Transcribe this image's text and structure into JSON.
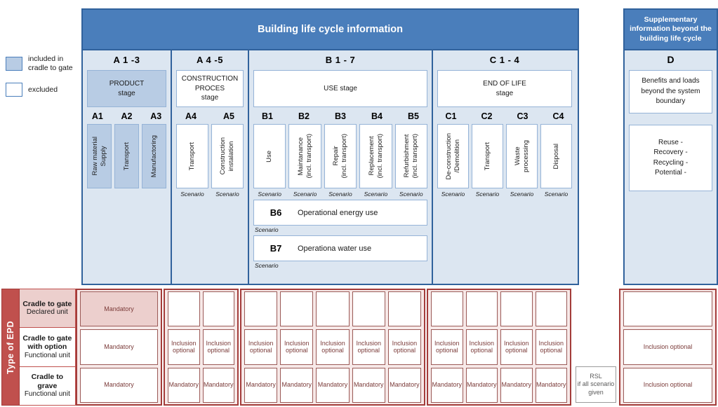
{
  "legend": {
    "items": [
      {
        "label": "included in\ncradle to gate",
        "swatch": "included",
        "color": "#b8cce4"
      },
      {
        "label": "excluded",
        "swatch": "excluded",
        "color": "#ffffff"
      }
    ]
  },
  "lifecycle": {
    "title": "Building life cycle information",
    "header_color": "#4a7ebb",
    "columns": [
      {
        "code": "A 1 -3",
        "stage": "PRODUCT\nstage",
        "stage_filled": true,
        "modules": [
          {
            "code": "A1",
            "label": "Raw material\nSupply",
            "filled": true,
            "scenario": ""
          },
          {
            "code": "A2",
            "label": "Transport",
            "filled": true,
            "scenario": ""
          },
          {
            "code": "A3",
            "label": "Manufactoring",
            "filled": true,
            "scenario": ""
          }
        ]
      },
      {
        "code": "A 4 -5",
        "stage": "CONSTRUCTION\nPROCES\nstage",
        "stage_filled": false,
        "modules": [
          {
            "code": "A4",
            "label": "Transport",
            "filled": false,
            "scenario": "Scenario"
          },
          {
            "code": "A5",
            "label": "Construction\ninstalation",
            "filled": false,
            "scenario": "Scenario"
          }
        ]
      },
      {
        "code": "B 1 - 7",
        "stage": "USE stage",
        "stage_filled": false,
        "modules": [
          {
            "code": "B1",
            "label": "Use",
            "filled": false,
            "scenario": "Scenario"
          },
          {
            "code": "B2",
            "label": "Maintanance\n(incl. transport)",
            "filled": false,
            "scenario": "Scenario"
          },
          {
            "code": "B3",
            "label": "Repair\n(incl. transport)",
            "filled": false,
            "scenario": "Scenario"
          },
          {
            "code": "B4",
            "label": "Replacement\n(incl. transport)",
            "filled": false,
            "scenario": "Scenario"
          },
          {
            "code": "B5",
            "label": "Refurbishment\n(incl. transport)",
            "filled": false,
            "scenario": "Scenario"
          }
        ],
        "wide_modules": [
          {
            "code": "B6",
            "label": "Operational energy use",
            "scenario": "Scenario"
          },
          {
            "code": "B7",
            "label": "Operationa water use",
            "scenario": "Scenario"
          }
        ]
      },
      {
        "code": "C 1 - 4",
        "stage": "END OF LIFE\nstage",
        "stage_filled": false,
        "modules": [
          {
            "code": "C1",
            "label": "De-construction\n/Demolition",
            "filled": false,
            "scenario": "Scenario"
          },
          {
            "code": "C2",
            "label": "Transport",
            "filled": false,
            "scenario": "Scenario"
          },
          {
            "code": "C3",
            "label": "Waste\nprocessing",
            "filled": false,
            "scenario": "Scenario"
          },
          {
            "code": "C4",
            "label": "Disposal",
            "filled": false,
            "scenario": "Scenario"
          }
        ]
      }
    ]
  },
  "supplementary": {
    "title": "Supplementary information beyond the building life cycle",
    "code": "D",
    "box1": "Benefits and loads\nbeyond the system\nboundary",
    "box2": "Reuse -\nRecovery -\nRecycling -\nPotential -"
  },
  "epd": {
    "side_label": "Type of EPD",
    "side_color": "#c0504d",
    "rows": [
      {
        "main": "Cradle to gate",
        "sub": "Declared unit",
        "shaded": true
      },
      {
        "main": "Cradle to gate\nwith option",
        "sub": "Functional unit",
        "shaded": false
      },
      {
        "main": "Cradle to\ngrave",
        "sub": "Functional unit",
        "shaded": false
      }
    ],
    "groups": [
      {
        "name": "a13",
        "cells": [
          [
            {
              "text": "Mandatory",
              "shaded": true
            }
          ],
          [
            {
              "text": "Mandatory",
              "shaded": false
            }
          ],
          [
            {
              "text": "Mandatory",
              "shaded": false
            }
          ]
        ]
      },
      {
        "name": "a45",
        "cells": [
          [
            {
              "text": "",
              "shaded": false
            },
            {
              "text": "",
              "shaded": false
            }
          ],
          [
            {
              "text": "Inclusion\noptional",
              "shaded": false
            },
            {
              "text": "Inclusion\noptional",
              "shaded": false
            }
          ],
          [
            {
              "text": "Mandatory",
              "shaded": false
            },
            {
              "text": "Mandatory",
              "shaded": false
            }
          ]
        ]
      },
      {
        "name": "b17",
        "cells": [
          [
            {
              "text": "",
              "shaded": false
            },
            {
              "text": "",
              "shaded": false
            },
            {
              "text": "",
              "shaded": false
            },
            {
              "text": "",
              "shaded": false
            },
            {
              "text": "",
              "shaded": false
            }
          ],
          [
            {
              "text": "Inclusion\noptional",
              "shaded": false
            },
            {
              "text": "Inclusion\noptional",
              "shaded": false
            },
            {
              "text": "Inclusion\noptional",
              "shaded": false
            },
            {
              "text": "Inclusion\noptional",
              "shaded": false
            },
            {
              "text": "Inclusion\noptional",
              "shaded": false
            }
          ],
          [
            {
              "text": "Mandatory",
              "shaded": false
            },
            {
              "text": "Mandatory",
              "shaded": false
            },
            {
              "text": "Mandatory",
              "shaded": false
            },
            {
              "text": "Mandatory",
              "shaded": false
            },
            {
              "text": "Mandatory",
              "shaded": false
            }
          ]
        ]
      },
      {
        "name": "c14",
        "cells": [
          [
            {
              "text": "",
              "shaded": false
            },
            {
              "text": "",
              "shaded": false
            },
            {
              "text": "",
              "shaded": false
            },
            {
              "text": "",
              "shaded": false
            }
          ],
          [
            {
              "text": "Inclusion\noptional",
              "shaded": false
            },
            {
              "text": "Inclusion\noptional",
              "shaded": false
            },
            {
              "text": "Inclusion\noptional",
              "shaded": false
            },
            {
              "text": "Inclusion\noptional",
              "shaded": false
            }
          ],
          [
            {
              "text": "Mandatory",
              "shaded": false
            },
            {
              "text": "Mandatory",
              "shaded": false
            },
            {
              "text": "Mandatory",
              "shaded": false
            },
            {
              "text": "Mandatory",
              "shaded": false
            }
          ]
        ]
      }
    ],
    "rsl_note": "RSL\nif all scenario\ngiven",
    "d_group": {
      "cells": [
        [
          {
            "text": "",
            "shaded": false
          }
        ],
        [
          {
            "text": "Inclusion optional",
            "shaded": false
          }
        ],
        [
          {
            "text": "Inclusion optional",
            "shaded": false
          }
        ]
      ]
    }
  }
}
